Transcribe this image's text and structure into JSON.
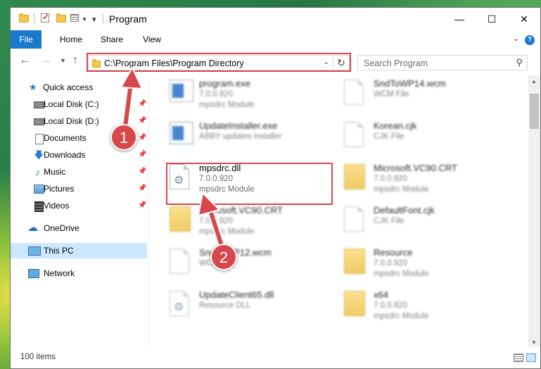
{
  "window": {
    "title": "Program"
  },
  "ribbon": {
    "tabs": [
      {
        "label": "File"
      },
      {
        "label": "Home"
      },
      {
        "label": "Share"
      },
      {
        "label": "View"
      }
    ]
  },
  "nav": {
    "address": "C:\\Program Files\\Program Directory",
    "search_placeholder": "Search Program"
  },
  "sidebar": {
    "quick_access": "Quick access",
    "items": [
      {
        "label": "Local Disk (C:)"
      },
      {
        "label": "Local Disk (D:)"
      },
      {
        "label": "Documents"
      },
      {
        "label": "Downloads"
      },
      {
        "label": "Music"
      },
      {
        "label": "Pictures"
      },
      {
        "label": "Videos"
      }
    ],
    "onedrive": "OneDrive",
    "this_pc": "This PC",
    "network": "Network"
  },
  "files": [
    {
      "name": "program.exe",
      "line2": "7.0.0.920",
      "line3": "mpsdrc Module"
    },
    {
      "name": "SndToWP14.wcm",
      "line2": "WCM File",
      "line3": ""
    },
    {
      "name": "UpdateInstaller.exe",
      "line2": "ABBY updates installer",
      "line3": ""
    },
    {
      "name": "Korean.cjk",
      "line2": "CJK File",
      "line3": ""
    },
    {
      "name": "mpsdrc.dll",
      "line2": "7.0.0.920",
      "line3": "mpsdrc Module"
    },
    {
      "name": "Microsoft.VC90.CRT",
      "line2": "7.0.0.920",
      "line3": "mpsdrc Module"
    },
    {
      "name": "Microsoft.VC90.CRT",
      "line2": "7.0.0.920",
      "line3": "mpsdrc Module"
    },
    {
      "name": "DefaultFont.cjk",
      "line2": "CJK File",
      "line3": ""
    },
    {
      "name": "SndToWP12.wcm",
      "line2": "WCM File",
      "line3": ""
    },
    {
      "name": "Resource",
      "line2": "7.0.0.920",
      "line3": "mpsdrc Module"
    },
    {
      "name": "UpdateClient65.dll",
      "line2": "Resource DLL",
      "line3": ""
    },
    {
      "name": "x64",
      "line2": "7.0.0.920",
      "line3": "mpsdrc Module"
    }
  ],
  "status": {
    "count": "100 items"
  },
  "callouts": [
    "1",
    "2"
  ],
  "colors": {
    "accent": "#1979ca",
    "highlight": "#d8474c",
    "selection": "#cce8ff"
  }
}
